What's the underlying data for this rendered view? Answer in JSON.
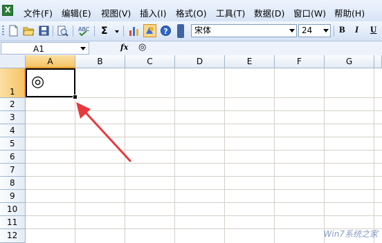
{
  "menubar": {
    "items": [
      {
        "label": "文件(F)"
      },
      {
        "label": "编辑(E)"
      },
      {
        "label": "视图(V)"
      },
      {
        "label": "插入(I)"
      },
      {
        "label": "格式(O)"
      },
      {
        "label": "工具(T)"
      },
      {
        "label": "数据(D)"
      },
      {
        "label": "窗口(W)"
      },
      {
        "label": "帮助(H)"
      }
    ]
  },
  "toolbar": {
    "autosum": "Σ",
    "font_name": "宋体",
    "font_size": "24",
    "bold": "B",
    "italic": "I",
    "underline": "U"
  },
  "formula_bar": {
    "name_box": "A1",
    "fx": "fx",
    "value": "◎"
  },
  "sheet": {
    "columns": [
      "A",
      "B",
      "C",
      "D",
      "E",
      "F",
      "G"
    ],
    "rows": [
      "1",
      "2",
      "3",
      "4",
      "5",
      "6",
      "7",
      "8",
      "9",
      "10",
      "11",
      "12"
    ],
    "active_cell": "A1",
    "cell_A1": "◎"
  },
  "annotation": {
    "color": "#e8383d"
  },
  "watermark": "Win7系统之家"
}
